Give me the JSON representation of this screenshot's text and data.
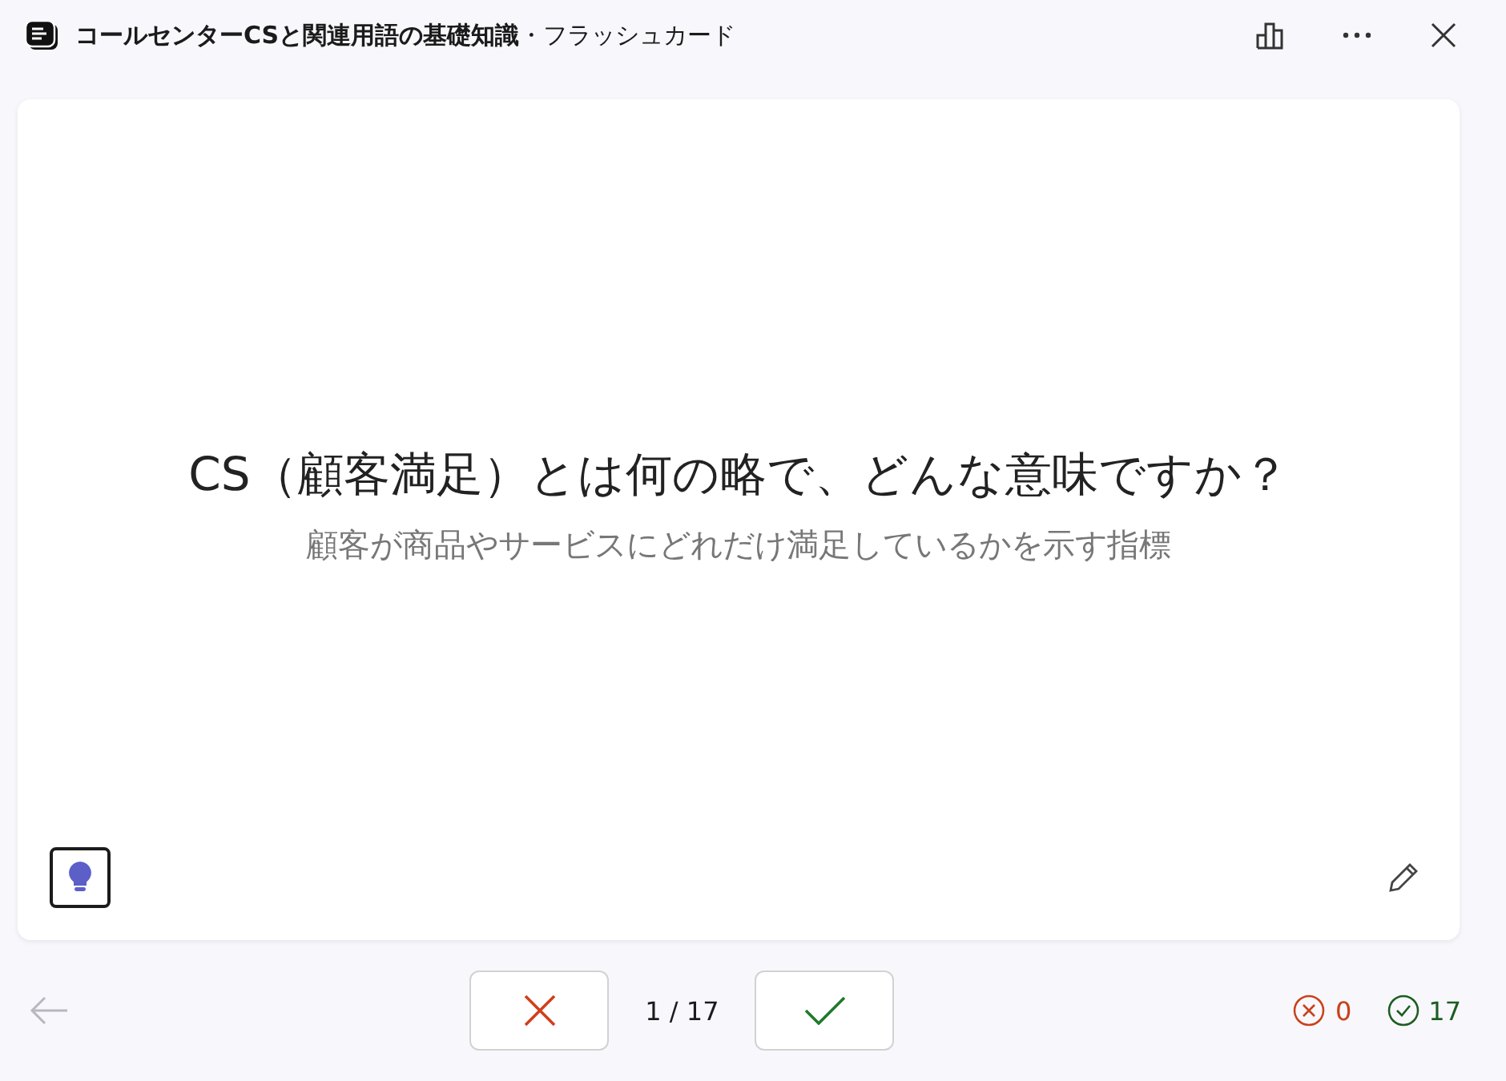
{
  "window": {
    "title": "コールセンターCSと関連用語の基礎知識",
    "subtitle": "・フラッシュカード"
  },
  "card": {
    "question": "CS（顧客満足）とは何の略で、どんな意味ですか？",
    "answer": "顧客が商品やサービスにどれだけ満足しているかを示す指標"
  },
  "navigation": {
    "back_disabled": true,
    "counter": "1 / 17"
  },
  "scores": {
    "wrong": "0",
    "correct": "17"
  }
}
